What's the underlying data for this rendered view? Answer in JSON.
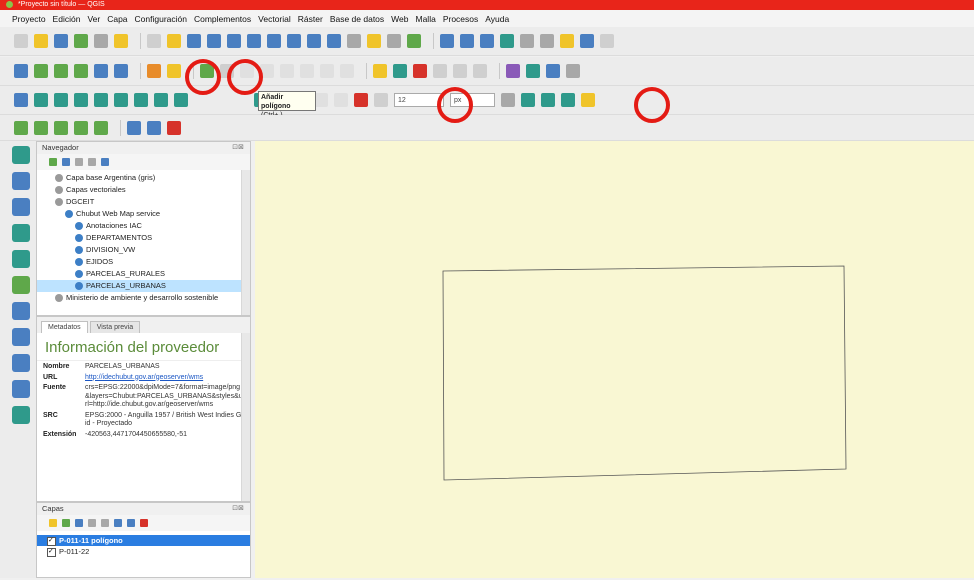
{
  "window": {
    "title": "*Proyecto sin título — QGIS"
  },
  "menu": [
    "Proyecto",
    "Edición",
    "Ver",
    "Capa",
    "Configuración",
    "Complementos",
    "Vectorial",
    "Ráster",
    "Base de datos",
    "Web",
    "Malla",
    "Procesos",
    "Ayuda"
  ],
  "toolbar3": {
    "tooltip_title": "Añadir polígono",
    "tooltip_shortcut": "(Ctrl+.)",
    "snap_value": "12",
    "snap_unit": "px"
  },
  "browser": {
    "title": "Navegador",
    "items": [
      {
        "label": "Capa base Argentina (gris)",
        "indent": 1,
        "glyph": "wms"
      },
      {
        "label": "Capas vectoriales",
        "indent": 1,
        "glyph": "wms"
      },
      {
        "label": "DGCEIT",
        "indent": 1,
        "glyph": "wms"
      },
      {
        "label": "Chubut Web Map service",
        "indent": 2,
        "glyph": "globe"
      },
      {
        "label": "Anotaciones IAC",
        "indent": 3,
        "glyph": "globe"
      },
      {
        "label": "DEPARTAMENTOS",
        "indent": 3,
        "glyph": "globe"
      },
      {
        "label": "DIVISION_VW",
        "indent": 3,
        "glyph": "globe"
      },
      {
        "label": "EJIDOS",
        "indent": 3,
        "glyph": "globe"
      },
      {
        "label": "PARCELAS_RURALES",
        "indent": 3,
        "glyph": "globe"
      },
      {
        "label": "PARCELAS_URBANAS",
        "indent": 3,
        "glyph": "globe",
        "selected": true
      },
      {
        "label": "Ministerio de ambiente y desarrollo sostenible",
        "indent": 1,
        "glyph": "wms"
      }
    ]
  },
  "metadata": {
    "tabs": [
      "Metadatos",
      "Vista previa"
    ],
    "heading": "Información del proveedor",
    "rows": [
      {
        "key": "Nombre",
        "value": "PARCELAS_URBANAS"
      },
      {
        "key": "URL",
        "value": "http://idechubut.gov.ar/geoserver/wms",
        "link": true
      },
      {
        "key": "Fuente",
        "value": "crs=EPSG:22000&dpiMode=7&format=image/png&layers=Chubut:PARCELAS_URBANAS&styles&url=http://ide.chubut.gov.ar/geoserver/wms"
      },
      {
        "key": "SRC",
        "value": "EPSG:2000 - Anguilla 1957 / British West Indies Grid - Proyectado"
      },
      {
        "key": "Extensión",
        "value": "-420563,4471704450655580,-51"
      }
    ]
  },
  "layers": {
    "title": "Capas",
    "items": [
      {
        "label": "P-011-11 polígono",
        "selected": true
      },
      {
        "label": "P-011-22",
        "selected": false
      }
    ]
  },
  "colors": {
    "titlebar": "#e8251a",
    "canvas": "#f9f7d3",
    "highlight": "#e41b14",
    "selection": "#2a7de1"
  }
}
